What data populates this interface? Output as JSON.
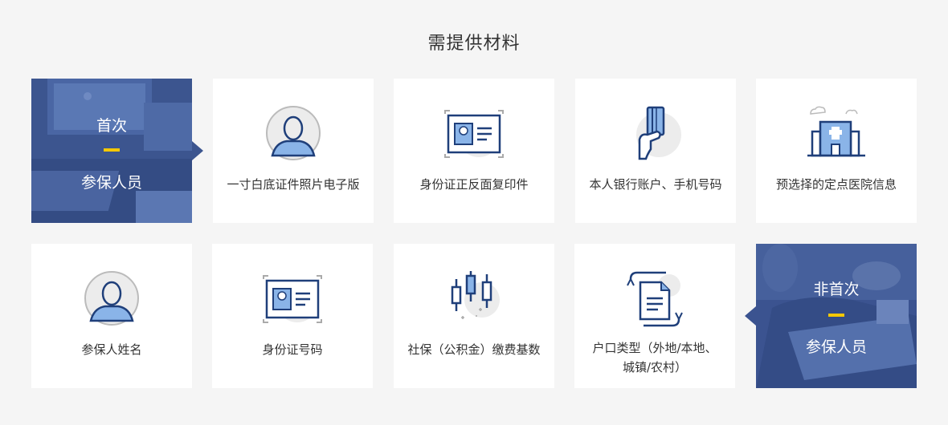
{
  "page": {
    "title": "需提供材料"
  },
  "first_time": {
    "line1": "首次",
    "line2": "参保人员"
  },
  "not_first_time": {
    "line1": "非首次",
    "line2": "参保人员"
  },
  "row1": [
    {
      "label": "一寸白底证件照片电子版",
      "icon": "person-photo-icon"
    },
    {
      "label": "身份证正反面复印件",
      "icon": "id-card-icon"
    },
    {
      "label": "本人银行账户、手机号码",
      "icon": "bank-card-hand-icon"
    },
    {
      "label": "预选择的定点医院信息",
      "icon": "hospital-icon"
    }
  ],
  "row2": [
    {
      "label": "参保人姓名",
      "icon": "person-icon"
    },
    {
      "label": "身份证号码",
      "icon": "id-card-icon"
    },
    {
      "label": "社保（公积金）缴费基数",
      "icon": "candlestick-chart-icon"
    },
    {
      "label_line1": "户口类型（外地/本地、",
      "label_line2": "城镇/农村）",
      "icon": "document-transfer-icon"
    }
  ],
  "colors": {
    "accent_blue": "#2a5aa8",
    "light_blue": "#8ab4e8",
    "icon_gray": "#e8e8e8",
    "feature_overlay": "#3b5390",
    "yellow_bar": "#f5c800"
  }
}
